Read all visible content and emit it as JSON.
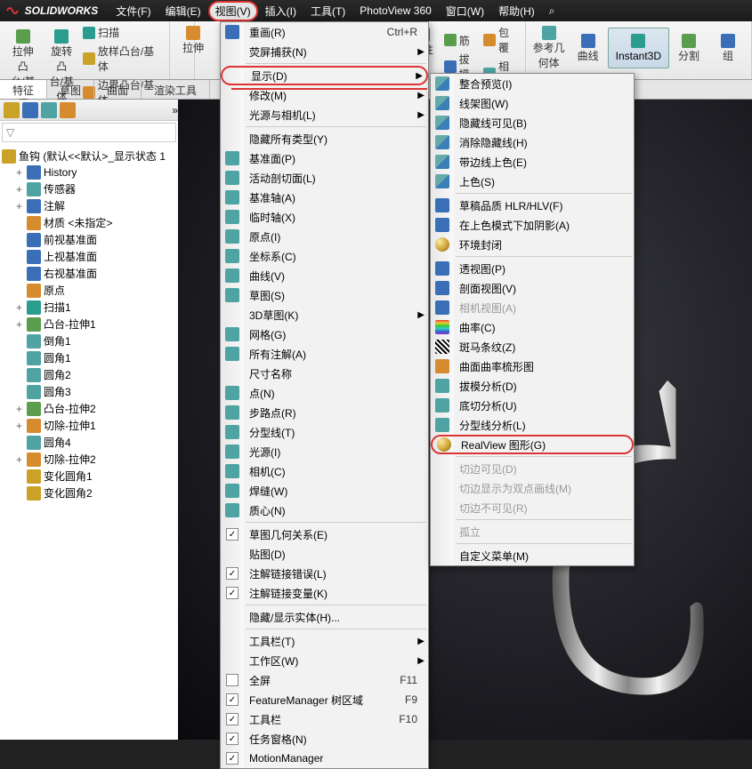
{
  "app": {
    "name": "SOLIDWORKS"
  },
  "menubar": [
    "文件(F)",
    "编辑(E)",
    "视图(V)",
    "插入(I)",
    "工具(T)",
    "PhotoView 360",
    "窗口(W)",
    "帮助(H)"
  ],
  "ribbon": {
    "group1": {
      "main": "拉伸凸\n台/基体",
      "rotate": "旋转凸\n台/基体"
    },
    "group1_side": [
      "扫描",
      "放样凸台/基体",
      "边界凸台/基体"
    ],
    "group2": {
      "main": "拉伸"
    },
    "group3": {
      "matrix": "线性阵\n列",
      "rib": "筋",
      "draft": "拔模",
      "wrap": "包覆",
      "intersect": "相交"
    },
    "group4": {
      "ref": "参考几\n何体",
      "curve": "曲线",
      "instant": "Instant3D",
      "split": "分割",
      "combine": "组"
    }
  },
  "tabs": [
    "特征",
    "草图",
    "曲面",
    "渲染工具",
    "S"
  ],
  "tree": {
    "root": "鱼钩  (默认<<默认>_显示状态 1",
    "items": [
      {
        "indent": 1,
        "exp": "+",
        "icon": "blue",
        "label": "History"
      },
      {
        "indent": 1,
        "exp": "+",
        "icon": "teal",
        "label": "传感器"
      },
      {
        "indent": 1,
        "exp": "+",
        "icon": "blue",
        "label": "注解"
      },
      {
        "indent": 1,
        "exp": "",
        "icon": "orange",
        "label": "材质 <未指定>"
      },
      {
        "indent": 1,
        "exp": "",
        "icon": "blue",
        "label": "前视基准面"
      },
      {
        "indent": 1,
        "exp": "",
        "icon": "blue",
        "label": "上视基准面"
      },
      {
        "indent": 1,
        "exp": "",
        "icon": "blue",
        "label": "右视基准面"
      },
      {
        "indent": 1,
        "exp": "",
        "icon": "orange",
        "label": "原点"
      },
      {
        "indent": 1,
        "exp": "+",
        "icon": "cyan",
        "label": "扫描1"
      },
      {
        "indent": 1,
        "exp": "+",
        "icon": "green",
        "label": "凸台-拉伸1"
      },
      {
        "indent": 1,
        "exp": "",
        "icon": "teal",
        "label": "倒角1"
      },
      {
        "indent": 1,
        "exp": "",
        "icon": "teal",
        "label": "圆角1"
      },
      {
        "indent": 1,
        "exp": "",
        "icon": "teal",
        "label": "圆角2"
      },
      {
        "indent": 1,
        "exp": "",
        "icon": "teal",
        "label": "圆角3"
      },
      {
        "indent": 1,
        "exp": "+",
        "icon": "green",
        "label": "凸台-拉伸2"
      },
      {
        "indent": 1,
        "exp": "+",
        "icon": "orange",
        "label": "切除-拉伸1"
      },
      {
        "indent": 1,
        "exp": "",
        "icon": "teal",
        "label": "圆角4"
      },
      {
        "indent": 1,
        "exp": "+",
        "icon": "orange",
        "label": "切除-拉伸2"
      },
      {
        "indent": 1,
        "exp": "",
        "icon": "yellow",
        "label": "变化圆角1"
      },
      {
        "indent": 1,
        "exp": "",
        "icon": "yellow",
        "label": "变化圆角2"
      }
    ]
  },
  "menu1": {
    "items": [
      {
        "label": "重画(R)",
        "shortcut": "Ctrl+R",
        "icon": "blue"
      },
      {
        "label": "荧屏捕获(N)",
        "arrow": true
      },
      {
        "sep": true
      },
      {
        "label": "显示(D)",
        "arrow": true,
        "hl": true
      },
      {
        "label": "修改(M)",
        "arrow": true
      },
      {
        "label": "光源与相机(L)",
        "arrow": true
      },
      {
        "sep": true
      },
      {
        "label": "隐藏所有类型(Y)"
      },
      {
        "label": "基准面(P)",
        "icon": "teal"
      },
      {
        "label": "活动剖切面(L)",
        "icon": "teal"
      },
      {
        "label": "基准轴(A)",
        "icon": "teal"
      },
      {
        "label": "临时轴(X)",
        "icon": "teal"
      },
      {
        "label": "原点(I)",
        "icon": "teal"
      },
      {
        "label": "坐标系(C)",
        "icon": "teal"
      },
      {
        "label": "曲线(V)",
        "icon": "teal"
      },
      {
        "label": "草图(S)",
        "icon": "teal"
      },
      {
        "label": "3D草图(K)",
        "arrow": true
      },
      {
        "label": "网格(G)",
        "icon": "teal"
      },
      {
        "label": "所有注解(A)",
        "icon": "teal"
      },
      {
        "label": "尺寸名称"
      },
      {
        "label": "点(N)",
        "icon": "teal"
      },
      {
        "label": "步路点(R)",
        "icon": "teal"
      },
      {
        "label": "分型线(T)",
        "icon": "teal"
      },
      {
        "label": "光源(I)",
        "icon": "teal"
      },
      {
        "label": "相机(C)",
        "icon": "teal"
      },
      {
        "label": "焊缝(W)",
        "icon": "teal"
      },
      {
        "label": "质心(N)",
        "icon": "teal"
      },
      {
        "sep": true
      },
      {
        "label": "草图几何关系(E)",
        "check": true,
        "icon": "teal"
      },
      {
        "label": "贴图(D)"
      },
      {
        "label": "注解链接错误(L)",
        "check": true
      },
      {
        "label": "注解链接变量(K)",
        "check": true
      },
      {
        "sep": true
      },
      {
        "label": "隐藏/显示实体(H)..."
      },
      {
        "sep": true
      },
      {
        "label": "工具栏(T)",
        "arrow": true
      },
      {
        "label": "工作区(W)",
        "arrow": true
      },
      {
        "label": "全屏",
        "shortcut": "F11",
        "check": false
      },
      {
        "label": "FeatureManager 树区域",
        "shortcut": "F9",
        "check": true
      },
      {
        "label": "工具栏",
        "shortcut": "F10",
        "check": true
      },
      {
        "label": "任务窗格(N)",
        "check": true
      },
      {
        "label": "MotionManager",
        "check": true
      }
    ]
  },
  "menu2": {
    "items": [
      {
        "label": "整合预览(I)",
        "icon": "cube-blue"
      },
      {
        "label": "线架图(W)",
        "icon": "cube-blue"
      },
      {
        "label": "隐藏线可见(B)",
        "icon": "cube-blue"
      },
      {
        "label": "消除隐藏线(H)",
        "icon": "cube-blue"
      },
      {
        "label": "带边线上色(E)",
        "icon": "cube-blue"
      },
      {
        "label": "上色(S)",
        "icon": "cube-blue"
      },
      {
        "sep": true
      },
      {
        "label": "草稿品质 HLR/HLV(F)",
        "icon": "blue"
      },
      {
        "label": "在上色模式下加阴影(A)",
        "icon": "blue"
      },
      {
        "label": "环境封闭",
        "icon": "gold-sphere"
      },
      {
        "sep": true
      },
      {
        "label": "透视图(P)",
        "icon": "blue"
      },
      {
        "label": "剖面视图(V)",
        "icon": "blue"
      },
      {
        "label": "相机视图(A)",
        "icon": "blue",
        "disabled": true
      },
      {
        "label": "曲率(C)",
        "icon": "rainbow"
      },
      {
        "label": "斑马条纹(Z)",
        "icon": "stripes"
      },
      {
        "label": "曲面曲率梳形图",
        "icon": "orange"
      },
      {
        "label": "拔模分析(D)",
        "icon": "teal"
      },
      {
        "label": "底切分析(U)",
        "icon": "teal"
      },
      {
        "label": "分型线分析(L)",
        "icon": "teal"
      },
      {
        "label": "RealView 图形(G)",
        "icon": "gold-sphere",
        "hl": true
      },
      {
        "sep": true
      },
      {
        "label": "切边可见(D)",
        "disabled": true
      },
      {
        "label": "切边显示为双点画线(M)",
        "disabled": true
      },
      {
        "label": "切边不可见(R)",
        "disabled": true
      },
      {
        "sep": true
      },
      {
        "label": "孤立",
        "disabled": true
      },
      {
        "sep": true
      },
      {
        "label": "自定义菜单(M)"
      }
    ]
  }
}
